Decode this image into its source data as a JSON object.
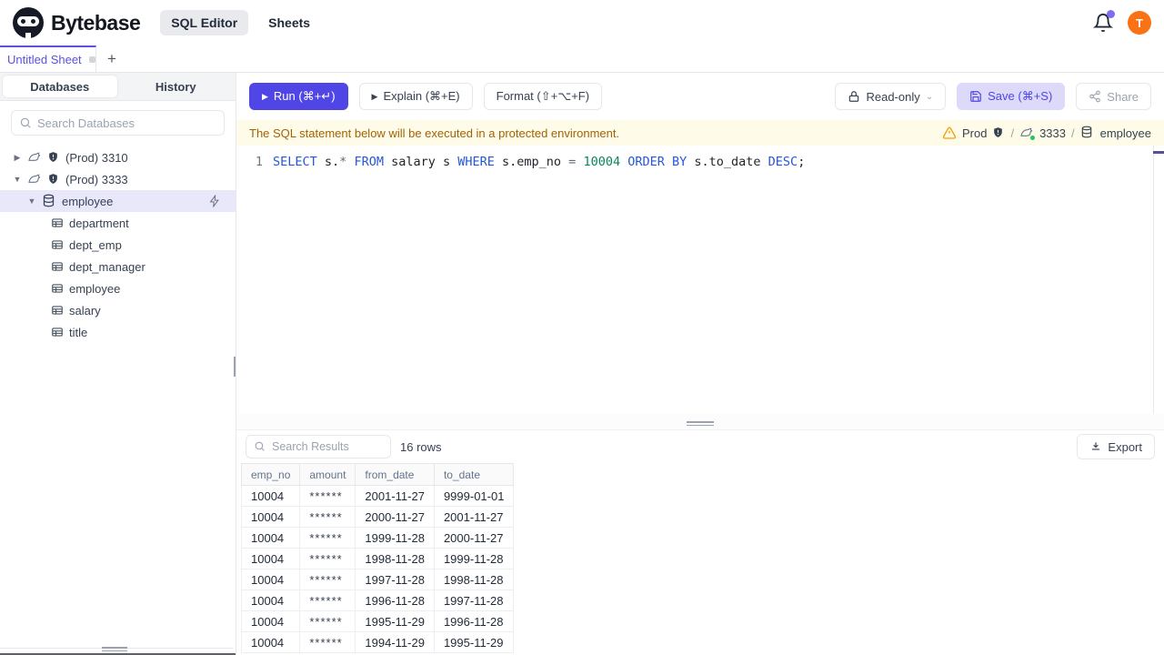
{
  "app": {
    "brand": "Bytebase",
    "nav": [
      {
        "label": "SQL Editor"
      },
      {
        "label": "Sheets"
      }
    ],
    "avatar_letter": "T"
  },
  "sheet_bar": {
    "active_sheet": "Untitled Sheet",
    "new_tab_label": "+"
  },
  "sidebar": {
    "tabs": [
      {
        "label": "Databases"
      },
      {
        "label": "History"
      }
    ],
    "search_placeholder": "Search Databases",
    "instances": [
      {
        "label": "(Prod) 3310"
      },
      {
        "label": "(Prod) 3333"
      }
    ],
    "database": "employee",
    "tables": [
      "department",
      "dept_emp",
      "dept_manager",
      "employee",
      "salary",
      "title"
    ]
  },
  "toolbar": {
    "run": "Run (⌘+↵)",
    "explain": "Explain (⌘+E)",
    "format": "Format (⇧+⌥+F)",
    "readonly": "Read-only",
    "save": "Save (⌘+S)",
    "share": "Share"
  },
  "banner": {
    "message": "The SQL statement below will be executed in a protected environment.",
    "environment": "Prod",
    "instance": "3333",
    "database": "employee",
    "separator": "/"
  },
  "editor": {
    "line_number": "1",
    "sql_text": "SELECT s.* FROM salary s WHERE s.emp_no = 10004 ORDER BY s.to_date DESC;",
    "sql_tokens": [
      {
        "text": "SELECT",
        "type": "kw"
      },
      {
        "text": " s.",
        "type": "id"
      },
      {
        "text": "*",
        "type": "op"
      },
      {
        "text": " ",
        "type": "id"
      },
      {
        "text": "FROM",
        "type": "kw"
      },
      {
        "text": " salary s ",
        "type": "id"
      },
      {
        "text": "WHERE",
        "type": "kw"
      },
      {
        "text": " s.emp_no ",
        "type": "id"
      },
      {
        "text": "=",
        "type": "op"
      },
      {
        "text": " ",
        "type": "id"
      },
      {
        "text": "10004",
        "type": "num"
      },
      {
        "text": " ",
        "type": "id"
      },
      {
        "text": "ORDER BY",
        "type": "kw"
      },
      {
        "text": " s.to_date ",
        "type": "id"
      },
      {
        "text": "DESC",
        "type": "kw"
      },
      {
        "text": ";",
        "type": "id"
      }
    ]
  },
  "results": {
    "search_placeholder": "Search Results",
    "row_count": "16 rows",
    "export": "Export",
    "table": {
      "columns": [
        "emp_no",
        "amount",
        "from_date",
        "to_date"
      ],
      "rows": [
        [
          "10004",
          "******",
          "2001-11-27",
          "9999-01-01"
        ],
        [
          "10004",
          "******",
          "2000-11-27",
          "2001-11-27"
        ],
        [
          "10004",
          "******",
          "1999-11-28",
          "2000-11-27"
        ],
        [
          "10004",
          "******",
          "1998-11-28",
          "1999-11-28"
        ],
        [
          "10004",
          "******",
          "1997-11-28",
          "1998-11-28"
        ],
        [
          "10004",
          "******",
          "1996-11-28",
          "1997-11-28"
        ],
        [
          "10004",
          "******",
          "1995-11-29",
          "1996-11-28"
        ],
        [
          "10004",
          "******",
          "1994-11-29",
          "1995-11-29"
        ]
      ]
    }
  },
  "colors": {
    "accent": "#4f46e5",
    "avatar": "#f97316",
    "banner_text": "#a16207",
    "warning": "#f59e0b",
    "keyword_blue": "#2857d5",
    "number_green": "#098658",
    "status_green": "#22c55e"
  }
}
